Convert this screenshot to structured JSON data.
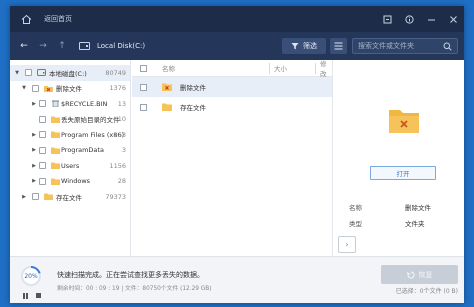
{
  "titlebar": {
    "title": "返回首页",
    "icons": [
      "home-icon",
      "restore-icon",
      "info-icon",
      "minimize-icon",
      "close-icon"
    ]
  },
  "toolbar": {
    "path": "Local Disk(C:)",
    "filter_label": "筛选",
    "search_placeholder": "搜索文件或文件夹"
  },
  "tree": {
    "items": [
      {
        "label": "本地磁盘(C:)",
        "count": "80749",
        "icon": "drive-icon"
      },
      {
        "label": "删除文件",
        "count": "1376",
        "icon": "deleted-folder-icon"
      },
      {
        "label": "$RECYCLE.BIN",
        "count": "13",
        "icon": "recycle-bin-icon"
      },
      {
        "label": "丢失原始目录的文件",
        "count": "10",
        "icon": "folder-icon"
      },
      {
        "label": "Program Files (x86)",
        "count": "163",
        "icon": "folder-icon"
      },
      {
        "label": "ProgramData",
        "count": "3",
        "icon": "folder-icon"
      },
      {
        "label": "Users",
        "count": "1156",
        "icon": "folder-icon"
      },
      {
        "label": "Windows",
        "count": "28",
        "icon": "folder-icon"
      },
      {
        "label": "存在文件",
        "count": "79373",
        "icon": "folder-icon"
      }
    ]
  },
  "list": {
    "headers": {
      "name": "名称",
      "size": "大小",
      "modified": "修改"
    },
    "rows": [
      {
        "name": "删除文件",
        "icon": "deleted-folder-icon"
      },
      {
        "name": "存在文件",
        "icon": "folder-icon"
      }
    ]
  },
  "preview": {
    "open_label": "打开",
    "props": [
      {
        "key": "名称",
        "value": "删除文件"
      },
      {
        "key": "类型",
        "value": "文件夹"
      }
    ]
  },
  "status": {
    "progress_text": "20%",
    "progress_fraction": 0.2,
    "message": "快速扫描完成。正在尝试查找更多丢失的数据。",
    "detail": "剩余时间：00 : 09 : 19 | 文件：80750个文件 (12.29 GB)",
    "recover_label": "恢复",
    "selected_info": "已选择：0个文件 (0 B)"
  },
  "colors": {
    "titlebar": "#1d2c48",
    "toolbar": "#24365a",
    "accent": "#3b7dd0",
    "folder": "#f6c35a"
  }
}
